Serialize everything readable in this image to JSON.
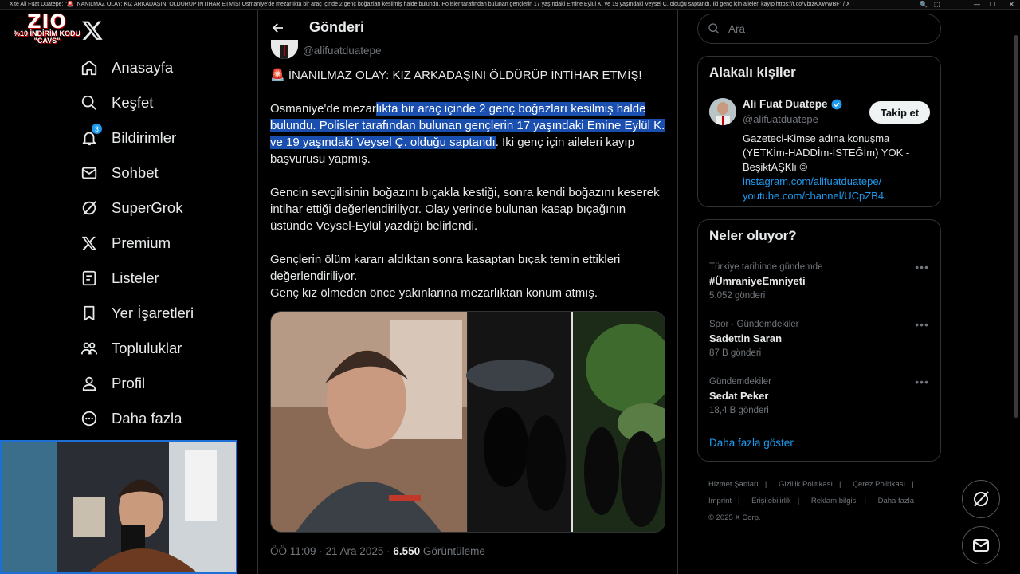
{
  "window": {
    "title": "X'te Ali Fuat Duatepe: \"🚨 İNANILMAZ OLAY: KIZ ARKADAŞINI ÖLDÜRÜP İNTİHAR ETMİŞ! Osmaniye'de mezarlıkta bir araç içinde 2 genç boğazları kesilmiş halde bulundu. Polisler tarafından bulunan gençlerin 17 yaşındaki Emine Eylül K. ve 19 yaşındaki Veysel Ç. olduğu saptandı. İki genç için aileleri kayıp https://t.co/VbIzKXWWBF\" / X"
  },
  "overlay": {
    "brand_big": "ZIO",
    "brand_small": "%10 İNDİRİM KODU",
    "brand_code": "\"CAVS\""
  },
  "nav": {
    "items": [
      {
        "label": "Anasayfa",
        "icon": "home-icon"
      },
      {
        "label": "Keşfet",
        "icon": "search-icon"
      },
      {
        "label": "Bildirimler",
        "icon": "bell-icon",
        "badge": "3"
      },
      {
        "label": "Sohbet",
        "icon": "mail-icon"
      },
      {
        "label": "SuperGrok",
        "icon": "grok-icon"
      },
      {
        "label": "Premium",
        "icon": "x-icon"
      },
      {
        "label": "Listeler",
        "icon": "list-icon"
      },
      {
        "label": "Yer İşaretleri",
        "icon": "bookmark-icon"
      },
      {
        "label": "Topluluklar",
        "icon": "communities-icon"
      },
      {
        "label": "Profil",
        "icon": "profile-icon"
      },
      {
        "label": "Daha fazla",
        "icon": "more-icon"
      }
    ]
  },
  "post": {
    "header_title": "Gönderi",
    "handle": "@alifuatduatepe",
    "headline_emoji": "🚨",
    "headline": "İNANILMAZ OLAY: KIZ ARKADAŞINI ÖLDÜRÜP İNTİHAR ETMİŞ!",
    "p1_pre": "Osmaniye'de mezar",
    "p1_hl": "lıkta bir araç içinde 2 genç boğazları kesilmiş halde bulundu. Polisler tarafından bulunan gençlerin 17 yaşındaki Emine Eylül K. ve 19 yaşındaki Veysel Ç. olduğu saptandı",
    "p1_post": ". İki genç için aileleri kayıp başvurusu yapmış.",
    "p2": "Gencin sevgilisinin boğazını bıçakla kestiği, sonra kendi boğazını keserek intihar ettiği değerlendiriliyor. Olay yerinde bulunan kasap bıçağının üstünde Veysel-Eylül yazdığı belirlendi.",
    "p3a": "Gençlerin ölüm kararı aldıktan sonra kasaptan bıçak temin ettikleri değerlendiriliyor.",
    "p3b": "Genç kız ölmeden önce yakınlarına mezarlıktan konum atmış.",
    "time": "ÖÖ 11:09 · 21 Ara 2025 · ",
    "views_count": "6.550",
    "views_label": " Görüntüleme"
  },
  "search": {
    "placeholder": "Ara"
  },
  "related": {
    "title": "Alakalı kişiler",
    "name": "Ali Fuat Duatepe",
    "handle": "@alifuatduatepe",
    "follow_label": "Takip et",
    "bio": "Gazeteci-Kimse adına konuşma (YETKİm-HADDİm-İSTEĞİm) YOK - BeşiktAŞKlı ©",
    "link1": "instagram.com/alifuatduatepe/",
    "link2": "youtube.com/channel/UCpZB4…"
  },
  "trends": {
    "title": "Neler oluyor?",
    "items": [
      {
        "category": "Türkiye tarihinde gündemde",
        "name": "#ÜmraniyeEmniyeti",
        "count": "5.052 gönderi"
      },
      {
        "category": "Spor · Gündemdekiler",
        "name": "Sadettin Saran",
        "count": "87 B gönderi"
      },
      {
        "category": "Gündemdekiler",
        "name": "Sedat Peker",
        "count": "18,4 B gönderi"
      }
    ],
    "show_more": "Daha fazla göster"
  },
  "footer": {
    "links": [
      "Hizmet Şartları",
      "Gizlilik Politikası",
      "Çerez Politikası",
      "Imprint",
      "Erişilebilirlik",
      "Reklam bilgisi",
      "Daha fazla ···"
    ],
    "copyright": "© 2025 X Corp."
  },
  "colors": {
    "accent": "#1d9bf0",
    "background": "#000000",
    "border": "#2f3336",
    "highlight": "#1a4fb0"
  }
}
